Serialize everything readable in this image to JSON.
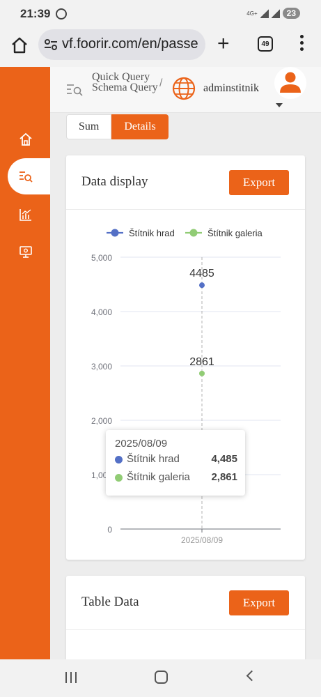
{
  "status_bar": {
    "time": "21:39",
    "network": "4G+",
    "battery": "23"
  },
  "browser": {
    "url": "vf.foorir.com/en/passe",
    "tab_count": "49"
  },
  "sidebar": {
    "items": [
      {
        "icon": "home-icon"
      },
      {
        "icon": "query-icon",
        "active": true
      },
      {
        "icon": "analytics-icon"
      },
      {
        "icon": "monitor-settings-icon"
      }
    ]
  },
  "header": {
    "breadcrumb": "Quick Query Schema Query",
    "separator": "/",
    "username": "adminstitnik"
  },
  "segment": {
    "sum_label": "Sum",
    "details_label": "Details"
  },
  "data_card": {
    "title": "Data display",
    "export_label": "Export"
  },
  "table_card": {
    "title": "Table Data",
    "export_label": "Export"
  },
  "colors": {
    "accent": "#eb6319",
    "series_blue": "#5470c6",
    "series_green": "#91cc75"
  },
  "chart_data": {
    "type": "scatter",
    "x": [
      "2025/08/09"
    ],
    "ylim": [
      0,
      5000
    ],
    "yticks": [
      0,
      1000,
      2000,
      3000,
      4000,
      5000
    ],
    "ytick_labels": [
      "0",
      "1,000",
      "2,000",
      "3,000",
      "4,000",
      "5,000"
    ],
    "legend_position": "top",
    "grid": true,
    "series": [
      {
        "name": "Štítnik hrad",
        "values": [
          4485
        ],
        "color": "#5470c6",
        "label": "4485"
      },
      {
        "name": "Štítnik galeria",
        "values": [
          2861
        ],
        "color": "#91cc75",
        "label": "2861"
      }
    ]
  },
  "tooltip": {
    "title": "2025/08/09",
    "rows": [
      {
        "name": "Štítnik hrad",
        "value": "4,485"
      },
      {
        "name": "Štítnik galeria",
        "value": "2,861"
      }
    ]
  }
}
